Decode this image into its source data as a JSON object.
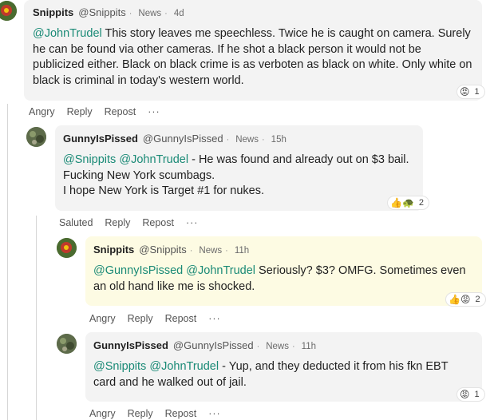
{
  "comments": [
    {
      "author": "Snippits",
      "handle": "@Snippits",
      "category": "News",
      "time": "4d",
      "mentions": [
        "@JohnTrudel"
      ],
      "text": " This story leaves me speechless. Twice he is caught on camera. Surely he can be found via other cameras. If he shot a black person it would not be publicized either. Black on black crime is as verboten as black on white. Only white on black is criminal in today's western world.",
      "reaction_emojis": "😡",
      "reaction_count": "1",
      "actions": [
        "Angry",
        "Reply",
        "Repost",
        "···"
      ]
    },
    {
      "author": "GunnyIsPissed",
      "handle": "@GunnyIsPissed",
      "category": "News",
      "time": "15h",
      "mentions": [
        "@Snippits",
        "@JohnTrudel"
      ],
      "text_line1": " - He was found and already out on $3 bail.",
      "text_line2": "Fucking New York scumbags.",
      "text_line3": "I hope New York is Target #1 for nukes.",
      "reaction_emojis": "👍🐢",
      "reaction_count": "2",
      "actions": [
        "Saluted",
        "Reply",
        "Repost",
        "···"
      ]
    },
    {
      "author": "Snippits",
      "handle": "@Snippits",
      "category": "News",
      "time": "11h",
      "mentions": [
        "@GunnyIsPissed",
        "@JohnTrudel"
      ],
      "text": " Seriously? $3? OMFG. Sometimes even an old hand like me is shocked.",
      "reaction_emojis": "👍😡",
      "reaction_count": "2",
      "actions": [
        "Angry",
        "Reply",
        "Repost",
        "···"
      ]
    },
    {
      "author": "GunnyIsPissed",
      "handle": "@GunnyIsPissed",
      "category": "News",
      "time": "11h",
      "mentions": [
        "@Snippits",
        "@JohnTrudel"
      ],
      "text": " - Yup, and they deducted it from his fkn EBT card and he walked out of jail.",
      "reaction_emojis": "😡",
      "reaction_count": "1",
      "actions": [
        "Angry",
        "Reply",
        "Repost",
        "···"
      ]
    }
  ],
  "icons": {
    "avatar_snippits": "red-flower-avatar",
    "avatar_gunny": "camo-soldier-avatar"
  }
}
